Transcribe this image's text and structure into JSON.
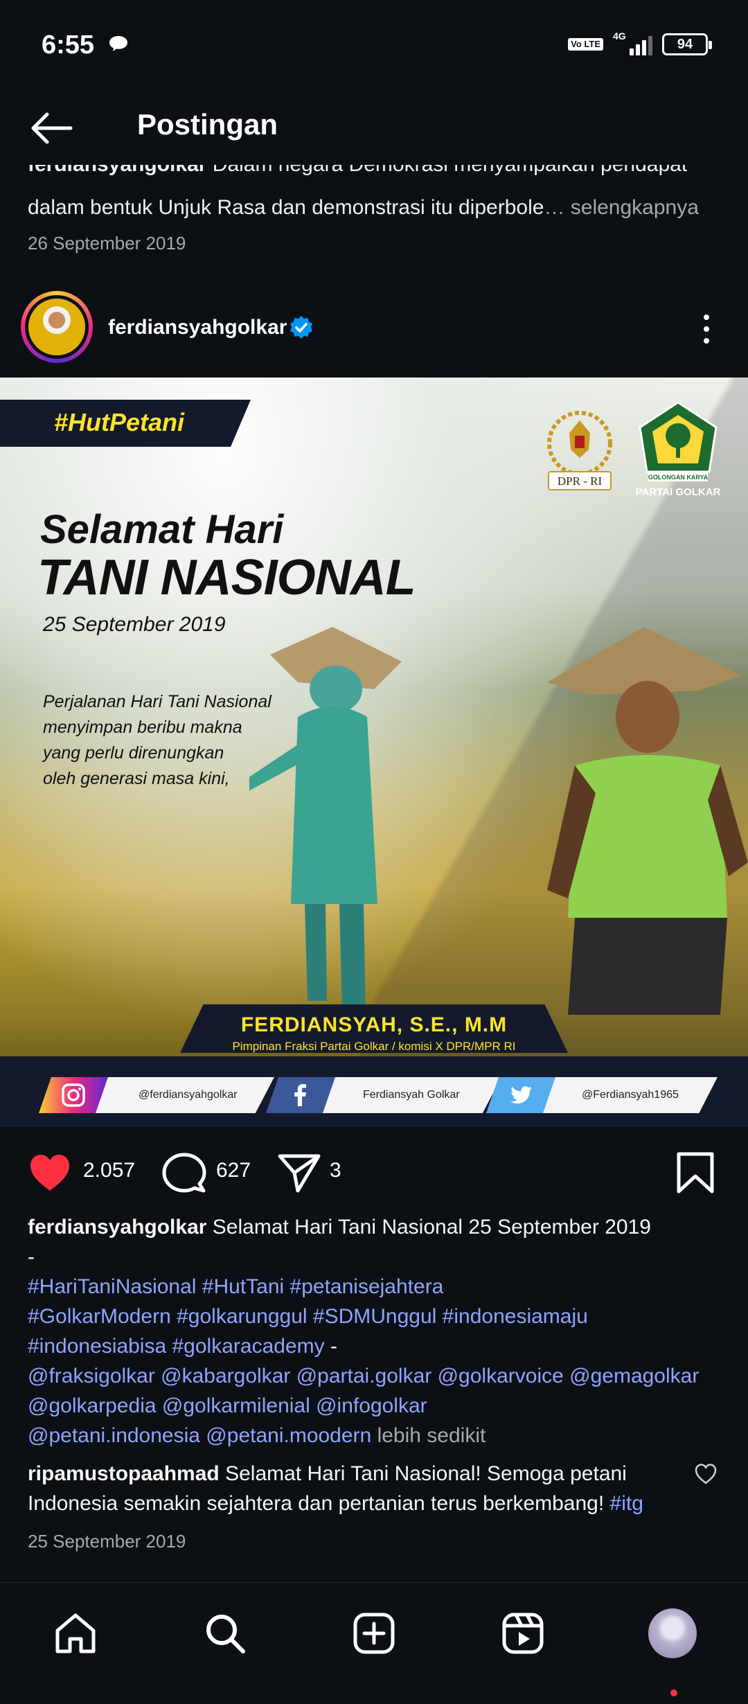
{
  "status_bar": {
    "time": "6:55",
    "volte": "Vo LTE",
    "network": "4G",
    "battery": "94"
  },
  "header": {
    "title": "Postingan"
  },
  "previous_post": {
    "caption_user": "ferdiansyahgolkar",
    "caption_text_clipped": "Dalam negara Demokrasi menyampaikan pendapat",
    "caption_line2": "dalam bentuk Unjuk Rasa dan demonstrasi itu diperbole",
    "more_label": "… selengkapnya",
    "date": "26 September 2019"
  },
  "post": {
    "username": "ferdiansyahgolkar",
    "image": {
      "hashtag_banner": "#HutPetani",
      "dpr_label": "DPR - RI",
      "golkar_label_top": "GOLONGAN KARYA",
      "golkar_label_bottom": "PARTAI GOLKAR",
      "title_line1": "Selamat Hari",
      "title_line2": "TANI NASIONAL",
      "title_date": "25 September 2019",
      "quote_lines": [
        "Perjalanan Hari Tani Nasional",
        "menyimpan beribu makna",
        "yang perlu direnungkan",
        "oleh generasi masa kini,"
      ],
      "name": "FERDIANSYAH, S.E., M.M",
      "name_subtitle": "Pimpinan Fraksi Partai Golkar / komisi X DPR/MPR RI",
      "social": [
        {
          "network": "instagram-icon",
          "handle": "@ferdiansyahgolkar"
        },
        {
          "network": "facebook-icon",
          "handle": "Ferdiansyah Golkar"
        },
        {
          "network": "twitter-icon",
          "handle": "@Ferdiansyah1965"
        }
      ]
    },
    "likes": "2.057",
    "comments": "627",
    "shares": "3",
    "caption": {
      "user": "ferdiansyahgolkar",
      "text": "Selamat Hari Tani Nasional 25 September 2019",
      "dash": "-",
      "hashtags_line1": "#HariTaniNasional #HutTani #petanisejahtera",
      "hashtags_line2": "#GolkarModern #golkarunggul #SDMUnggul #indonesiamaju",
      "hashtags_line3": "#indonesiabisa #golkaracademy",
      "dash2": " -",
      "mentions_line1": "@fraksigolkar @kabargolkar @partai.golkar @golkarvoice @gemagolkar",
      "mentions_line2": "@golkarpedia @golkarmilenial @infogolkar",
      "mentions_line3": "@petani.indonesia @petani.moodern",
      "less_label": " lebih sedikit"
    },
    "top_comment": {
      "user": "ripamustopaahmad",
      "text": "Selamat Hari Tani Nasional! Semoga petani Indonesia semakin sejahtera dan pertanian terus berkembang! ",
      "hashtag": "#itg"
    },
    "date": "25 September 2019"
  },
  "colors": {
    "background": "#0c1014",
    "link": "#8ea4ff",
    "like_red": "#ff3040",
    "verified_blue": "#0095f6",
    "banner_yellow": "#ffe32a"
  },
  "bottom_nav": [
    "home-icon",
    "search-icon",
    "create-icon",
    "reels-icon",
    "profile-avatar"
  ]
}
